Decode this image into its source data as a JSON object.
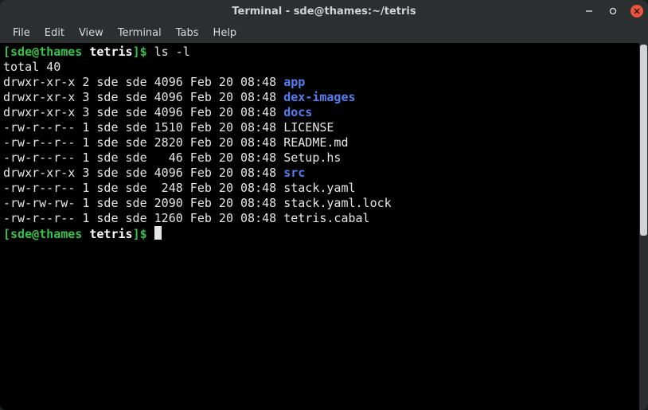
{
  "window": {
    "title": "Terminal - sde@thames:~/tetris"
  },
  "menubar": {
    "items": [
      "File",
      "Edit",
      "View",
      "Terminal",
      "Tabs",
      "Help"
    ]
  },
  "prompt": {
    "open": "[",
    "user_host": "sde@thames",
    "sep": " ",
    "cwd": "tetris",
    "close": "]$ "
  },
  "command": "ls -l",
  "total_line": "total 40",
  "listing": [
    {
      "meta": "drwxr-xr-x 2 sde sde 4096 Feb 20 08:48 ",
      "name": "app",
      "dir": true
    },
    {
      "meta": "drwxr-xr-x 3 sde sde 4096 Feb 20 08:48 ",
      "name": "dex-images",
      "dir": true
    },
    {
      "meta": "drwxr-xr-x 3 sde sde 4096 Feb 20 08:48 ",
      "name": "docs",
      "dir": true
    },
    {
      "meta": "-rw-r--r-- 1 sde sde 1510 Feb 20 08:48 ",
      "name": "LICENSE",
      "dir": false
    },
    {
      "meta": "-rw-r--r-- 1 sde sde 2820 Feb 20 08:48 ",
      "name": "README.md",
      "dir": false
    },
    {
      "meta": "-rw-r--r-- 1 sde sde   46 Feb 20 08:48 ",
      "name": "Setup.hs",
      "dir": false
    },
    {
      "meta": "drwxr-xr-x 3 sde sde 4096 Feb 20 08:48 ",
      "name": "src",
      "dir": true
    },
    {
      "meta": "-rw-r--r-- 1 sde sde  248 Feb 20 08:48 ",
      "name": "stack.yaml",
      "dir": false
    },
    {
      "meta": "-rw-rw-rw- 1 sde sde 2090 Feb 20 08:48 ",
      "name": "stack.yaml.lock",
      "dir": false
    },
    {
      "meta": "-rw-r--r-- 1 sde sde 1260 Feb 20 08:48 ",
      "name": "tetris.cabal",
      "dir": false
    }
  ]
}
